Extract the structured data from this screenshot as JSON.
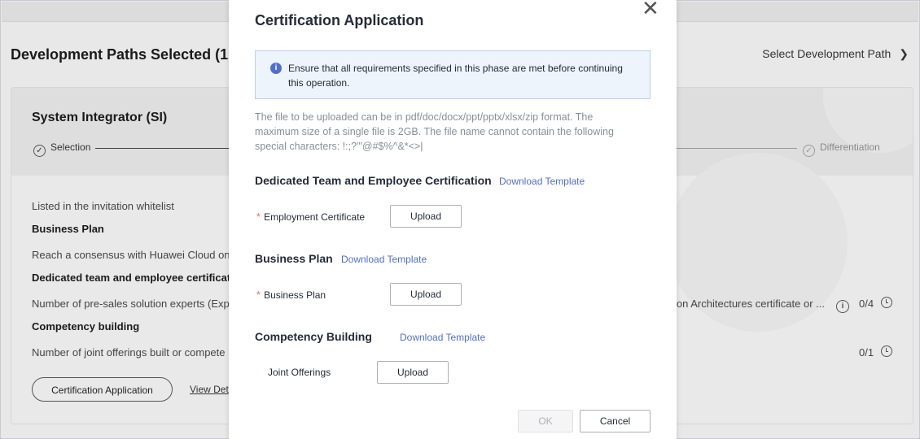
{
  "background": {
    "title": "Development Paths Selected (1",
    "select_path_link": "Select Development Path",
    "chevron": "chevron-right-icon",
    "card": {
      "name": "System Integrator (SI)",
      "stage_first": "Selection",
      "stage_last": "Differentiation",
      "rows": {
        "whitelist": "Listed in the invitation whitelist",
        "business_plan_heading": "Business Plan",
        "consensus": "Reach a consensus with Huawei Cloud on t",
        "dedicated_heading": "Dedicated team and employee certificati",
        "presales": "Number of pre-sales solution experts (Exp",
        "presales_right": "ion Architectures certificate or ...",
        "presales_count": "0/4",
        "competency_heading": "Competency building",
        "joint": "Number of joint offerings built or compete",
        "joint_count": "0/1"
      },
      "cert_button": "Certification Application",
      "view_details": "View Det"
    }
  },
  "modal": {
    "title": "Certification Application",
    "alert": "Ensure that all requirements specified in this phase are met before continuing this operation.",
    "note": "The file to be uploaded can be in pdf/doc/docx/ppt/pptx/xlsx/zip format. The maximum size of a single file is 2GB. The file name cannot contain the following special characters: !:;?'\"@#$%^&*<>|",
    "sections": [
      {
        "heading": "Dedicated Team and Employee Certification",
        "download": "Download Template",
        "field": "Employment Certificate",
        "required": true,
        "upload": "Upload"
      },
      {
        "heading": "Business Plan",
        "download": "Download Template",
        "field": "Business Plan",
        "required": true,
        "upload": "Upload"
      },
      {
        "heading": "Competency Building",
        "download": "Download Template",
        "field": "Joint Offerings",
        "required": false,
        "upload": "Upload"
      }
    ],
    "required_mark": "*",
    "ok": "OK",
    "cancel": "Cancel",
    "colors": {
      "accent": "#526ecc",
      "required": "#f66f6a",
      "alert_bg": "#eef4fc"
    }
  }
}
